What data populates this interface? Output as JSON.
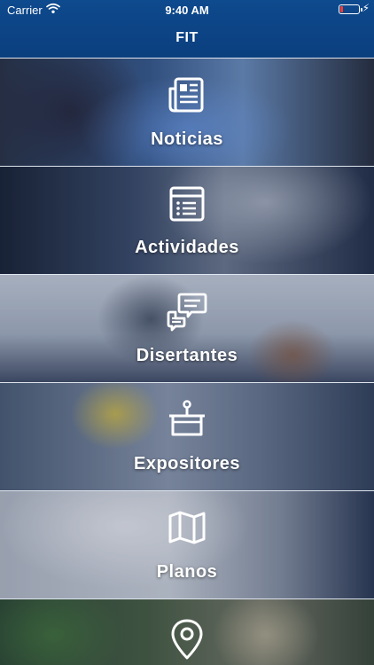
{
  "status_bar": {
    "carrier": "Carrier",
    "time": "9:40 AM"
  },
  "nav": {
    "title": "FIT"
  },
  "menu": [
    {
      "label": "Noticias",
      "icon": "newspaper-icon"
    },
    {
      "label": "Actividades",
      "icon": "calendar-list-icon"
    },
    {
      "label": "Disertantes",
      "icon": "chat-bubbles-icon"
    },
    {
      "label": "Expositores",
      "icon": "exhibitor-booth-icon"
    },
    {
      "label": "Planos",
      "icon": "map-icon"
    },
    {
      "label": "",
      "icon": "location-pin-icon"
    }
  ],
  "colors": {
    "nav_background": "#0b3f7e",
    "battery_low": "#ff3b30"
  }
}
